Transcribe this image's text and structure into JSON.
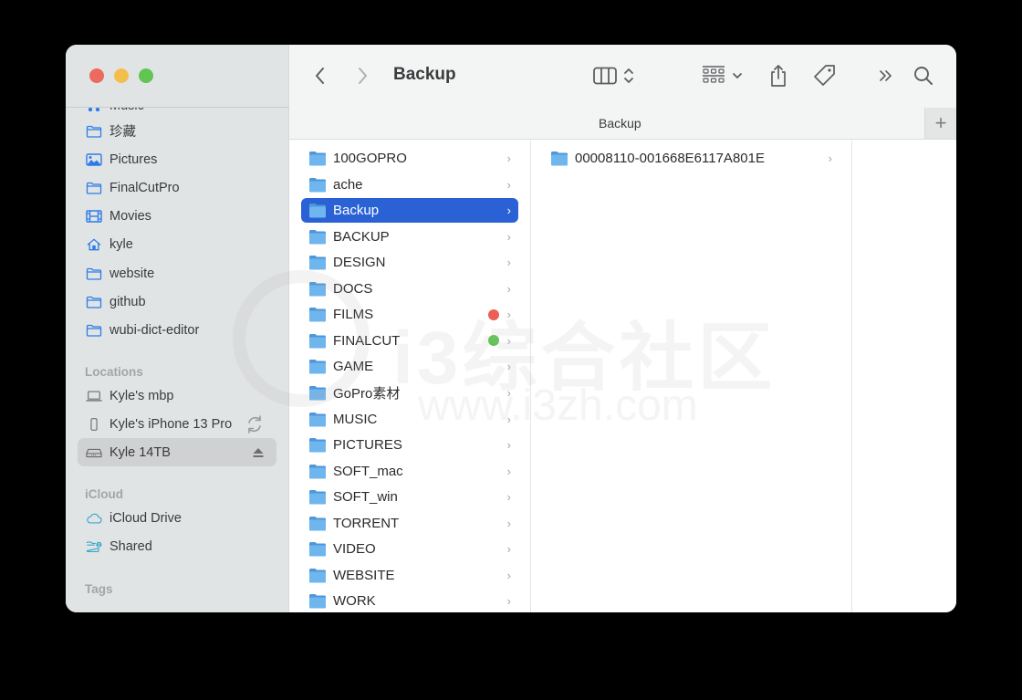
{
  "window": {
    "title": "Backup",
    "path_bar_title": "Backup",
    "add_tab_label": "+"
  },
  "toolbar": {
    "back_icon": "chevron-left-icon",
    "forward_icon": "chevron-right-icon",
    "view_icon": "column-view-icon",
    "group_icon": "group-grid-icon",
    "share_icon": "share-icon",
    "tag_icon": "tag-icon",
    "more_icon": "double-chevron-right-icon",
    "search_icon": "search-icon"
  },
  "sidebar": {
    "partial_top_item": "Music",
    "favorites": [
      {
        "label": "珍藏",
        "icon": "folder-icon"
      },
      {
        "label": "Pictures",
        "icon": "pictures-icon"
      },
      {
        "label": "FinalCutPro",
        "icon": "folder-icon"
      },
      {
        "label": "Movies",
        "icon": "film-icon"
      },
      {
        "label": "kyle",
        "icon": "home-icon"
      },
      {
        "label": "website",
        "icon": "folder-icon"
      },
      {
        "label": "github",
        "icon": "folder-icon"
      },
      {
        "label": "wubi-dict-editor",
        "icon": "folder-icon"
      }
    ],
    "locations_header": "Locations",
    "locations": [
      {
        "label": "Kyle's mbp",
        "icon": "laptop-icon"
      },
      {
        "label": "Kyle's iPhone 13 Pro",
        "icon": "iphone-icon",
        "trailing": "sync-icon"
      },
      {
        "label": "Kyle 14TB",
        "icon": "external-drive-icon",
        "trailing": "eject-icon",
        "selected": true
      }
    ],
    "icloud_header": "iCloud",
    "icloud": [
      {
        "label": "iCloud Drive",
        "icon": "cloud-icon"
      },
      {
        "label": "Shared",
        "icon": "shared-folder-icon"
      }
    ],
    "tags_header": "Tags"
  },
  "columns": {
    "col1": [
      {
        "name": "100GOPRO"
      },
      {
        "name": "ache"
      },
      {
        "name": "Backup",
        "selected": true
      },
      {
        "name": "BACKUP"
      },
      {
        "name": "DESIGN"
      },
      {
        "name": "DOCS"
      },
      {
        "name": "FILMS",
        "tag_color": "#ec5f57"
      },
      {
        "name": "FINALCUT",
        "tag_color": "#5fc452"
      },
      {
        "name": "GAME"
      },
      {
        "name": "GoPro素材"
      },
      {
        "name": "MUSIC"
      },
      {
        "name": "PICTURES"
      },
      {
        "name": "SOFT_mac"
      },
      {
        "name": "SOFT_win"
      },
      {
        "name": "TORRENT"
      },
      {
        "name": "VIDEO"
      },
      {
        "name": "WEBSITE"
      },
      {
        "name": "WORK"
      }
    ],
    "col2": [
      {
        "name": "00008110-001668E6117A801E"
      }
    ],
    "chevron": "›"
  },
  "watermark": {
    "text": "i3综合社区",
    "url": "www.i3zh.com"
  },
  "colors": {
    "accent": "#2a62d6",
    "sidebar_bg": "#e1e4e5",
    "toolbar_bg": "#f3f5f5",
    "folder_blue": "#69b1ec"
  }
}
